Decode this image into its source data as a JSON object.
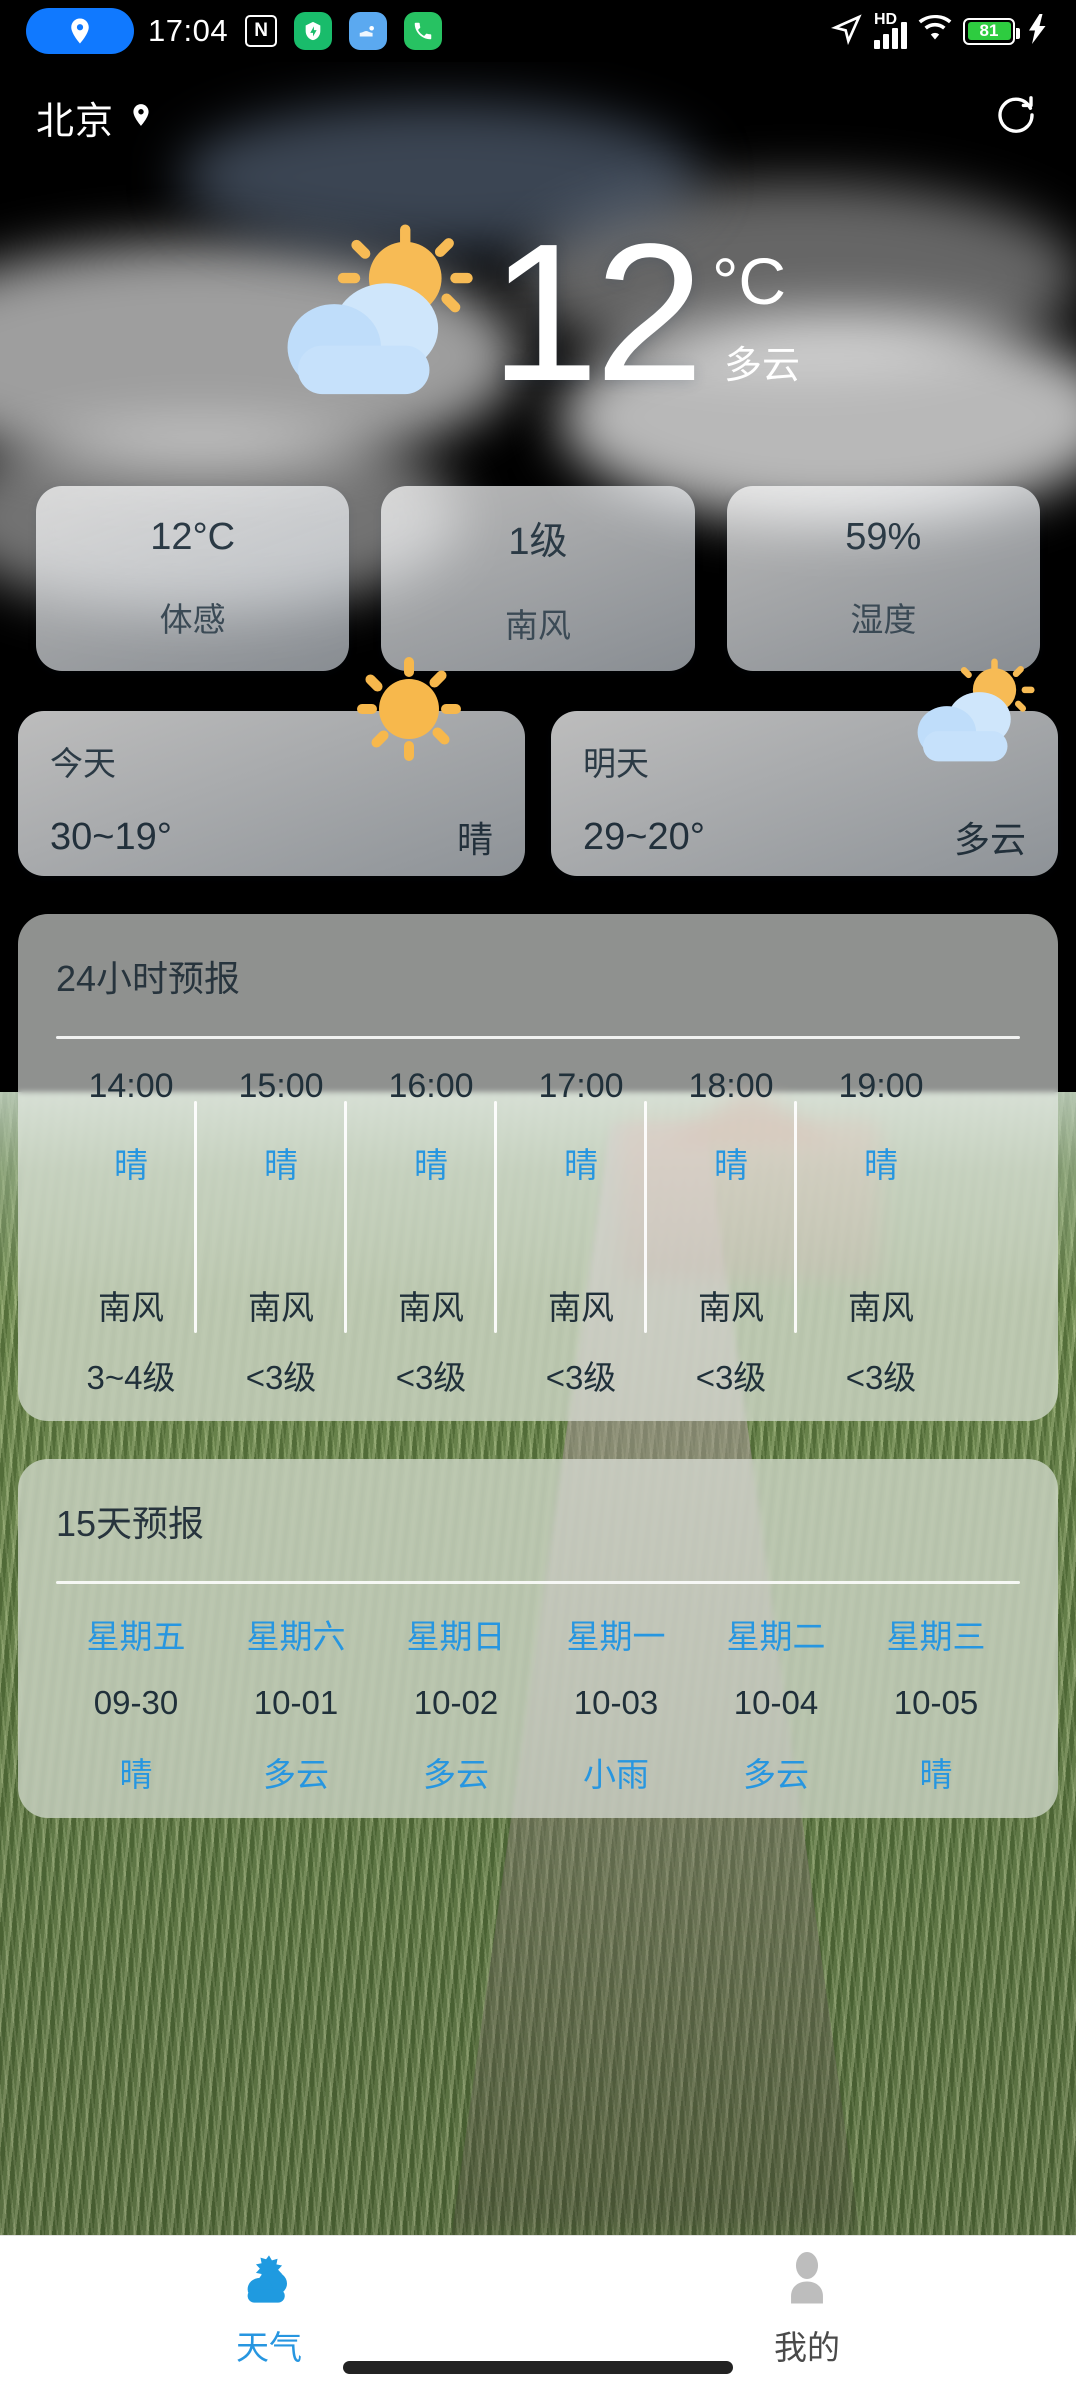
{
  "statusbar": {
    "time": "17:04",
    "nfc_label": "N",
    "hd_label": "HD",
    "battery_percent": "81",
    "icons": [
      "location-pill-icon",
      "nfc-icon",
      "app-shield-icon",
      "app-mail-icon",
      "app-phone-icon",
      "navigation-icon",
      "hd-icon",
      "signal-icon",
      "wifi-icon",
      "battery-icon",
      "charging-bolt-icon"
    ]
  },
  "header": {
    "city": "北京",
    "location_icon": "location-pin-icon",
    "refresh_icon": "refresh-icon"
  },
  "current": {
    "temperature": "12",
    "unit": "°C",
    "condition": "多云",
    "icon": "sun-behind-cloud-icon"
  },
  "metrics": [
    {
      "value": "12°C",
      "label": "体感",
      "name": "feels-like"
    },
    {
      "value": "1级",
      "label": "南风",
      "name": "wind"
    },
    {
      "value": "59%",
      "label": "湿度",
      "name": "humidity"
    }
  ],
  "day_cards": [
    {
      "label": "今天",
      "range": "30~19°",
      "condition": "晴",
      "icon": "sun-icon"
    },
    {
      "label": "明天",
      "range": "29~20°",
      "condition": "多云",
      "icon": "sun-behind-cloud-icon"
    }
  ],
  "hourly": {
    "title": "24小时预报",
    "items": [
      {
        "time": "14:00",
        "condition": "晴",
        "wind": "南风",
        "level": "3~4级"
      },
      {
        "time": "15:00",
        "condition": "晴",
        "wind": "南风",
        "level": "<3级"
      },
      {
        "time": "16:00",
        "condition": "晴",
        "wind": "南风",
        "level": "<3级"
      },
      {
        "time": "17:00",
        "condition": "晴",
        "wind": "南风",
        "level": "<3级"
      },
      {
        "time": "18:00",
        "condition": "晴",
        "wind": "南风",
        "level": "<3级"
      },
      {
        "time": "19:00",
        "condition": "晴",
        "wind": "南风",
        "level": "<3级"
      }
    ]
  },
  "daily": {
    "title": "15天预报",
    "items": [
      {
        "weekday": "星期五",
        "date": "09-30",
        "condition": "晴"
      },
      {
        "weekday": "星期六",
        "date": "10-01",
        "condition": "多云"
      },
      {
        "weekday": "星期日",
        "date": "10-02",
        "condition": "多云"
      },
      {
        "weekday": "星期一",
        "date": "10-03",
        "condition": "小雨"
      },
      {
        "weekday": "星期二",
        "date": "10-04",
        "condition": "多云"
      },
      {
        "weekday": "星期三",
        "date": "10-05",
        "condition": "晴"
      }
    ]
  },
  "nav": [
    {
      "label": "天气",
      "icon": "weather-sun-cloud-icon",
      "active": true
    },
    {
      "label": "我的",
      "icon": "person-icon",
      "active": false
    }
  ],
  "colors": {
    "accent": "#2796E0",
    "battery_green": "#2ECC40",
    "location_blue": "#1079FF",
    "sun_orange": "#F5B54A"
  }
}
